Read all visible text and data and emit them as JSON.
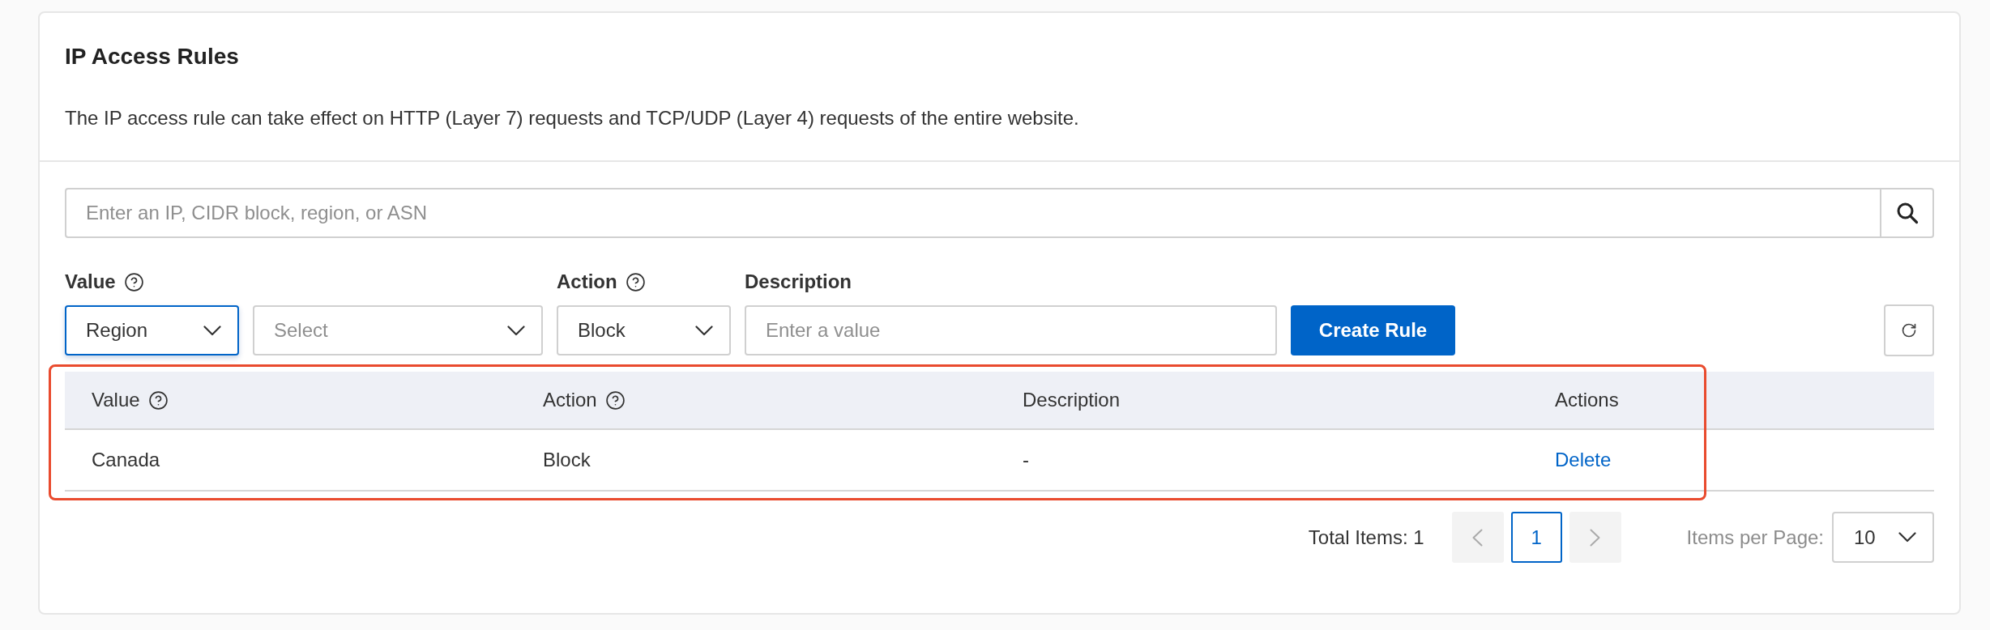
{
  "card": {
    "title": "IP Access Rules",
    "description": "The IP access rule can take effect on HTTP (Layer 7) requests and TCP/UDP (Layer 4) requests of the entire website."
  },
  "search": {
    "placeholder": "Enter an IP, CIDR block, region, or ASN"
  },
  "form": {
    "labels": [
      {
        "text": "Value",
        "help": true
      },
      {
        "text": "Action",
        "help": true
      },
      {
        "text": "Description",
        "help": false
      }
    ],
    "value_type": {
      "value": "Region",
      "focused": true
    },
    "value_select": {
      "placeholder": "Select",
      "focused": false
    },
    "action": {
      "value": "Block",
      "focused": false
    },
    "description": {
      "placeholder": "Enter a value"
    },
    "create_button": "Create Rule"
  },
  "table": {
    "highlighted": true,
    "columns": [
      {
        "label": "Value",
        "help": true
      },
      {
        "label": "Action",
        "help": true
      },
      {
        "label": "Description",
        "help": false
      },
      {
        "label": "Actions",
        "help": false
      }
    ],
    "rows": [
      {
        "cells": [
          {
            "kind": "text",
            "text": "Canada"
          },
          {
            "kind": "text",
            "text": "Block"
          },
          {
            "kind": "text",
            "text": "-"
          },
          {
            "kind": "link",
            "text": "Delete"
          }
        ]
      }
    ]
  },
  "pagination": {
    "total": "Total Items: 1",
    "prev": {
      "disabled": true
    },
    "pages": [
      {
        "label": "1",
        "selected": true
      }
    ],
    "next": {
      "disabled": true
    },
    "page_size_label": "Items per Page:",
    "page_size": "10"
  }
}
